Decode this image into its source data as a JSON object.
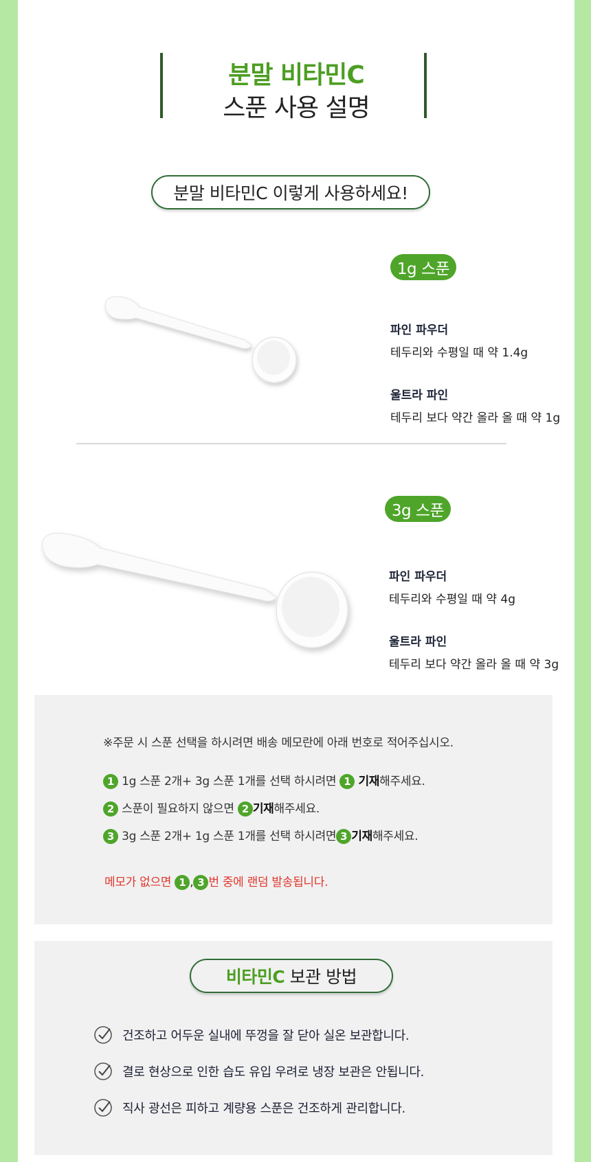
{
  "header": {
    "title_line1": "분말 비타민C",
    "title_line2": "스푼 사용 설명"
  },
  "usage_pill": "분말 비타민C 이렇게 사용하세요!",
  "spoon_1g": {
    "badge": "1g 스푼",
    "fine_title": "파인 파우더",
    "fine_desc": "테두리와 수평일 때 약 1.4g",
    "ultra_title": "울트라 파인",
    "ultra_desc": "테두리 보다 약간 올라 올 때 약 1g"
  },
  "spoon_3g": {
    "badge": "3g 스푼",
    "fine_title": "파인 파우더",
    "fine_desc": "테두리와 수평일 때 약 4g",
    "ultra_title": "울트라 파인",
    "ultra_desc": "테두리 보다 약간 올라 올 때 약 3g"
  },
  "order_notice": {
    "intro": "※주문 시 스푼 선택을 하시려면 배송 메모란에 아래 번호로 적어주십시오.",
    "options": [
      {
        "num": "1",
        "text": "1g 스푼 2개+ 3g 스푼 1개를 선택 하시려면",
        "bold": "기재",
        "suffix": "해주세요."
      },
      {
        "num": "2",
        "text": "스푼이 필요하지 않으면",
        "bold": "기재",
        "suffix": "해주세요."
      },
      {
        "num": "3",
        "text": "3g 스푼 2개+ 1g 스푼 1개를 선택 하시려면",
        "bold": "기재",
        "suffix": "해주세요."
      }
    ],
    "memo_prefix": "메모가 없으면",
    "memo_num1": "1",
    "memo_comma": ",",
    "memo_num2": "3",
    "memo_suffix": "번 중에 랜덤 발송됩니다."
  },
  "storage": {
    "title_green": "비타민C",
    "title_rest": " 보관 방법",
    "items": [
      "건조하고 어두운 실내에 뚜껑을 잘 닫아 실온 보관합니다.",
      "결로 현상으로 인한 습도 유입 우려로 냉장 보관은 안됩니다.",
      "직사 광선은 피하고 계량용 스푼은 건조하게 관리합니다."
    ]
  },
  "colors": {
    "green": "#4ea52a",
    "dark_green": "#2f6c35",
    "red": "#e0362b",
    "side_green": "#b5e8a2"
  }
}
